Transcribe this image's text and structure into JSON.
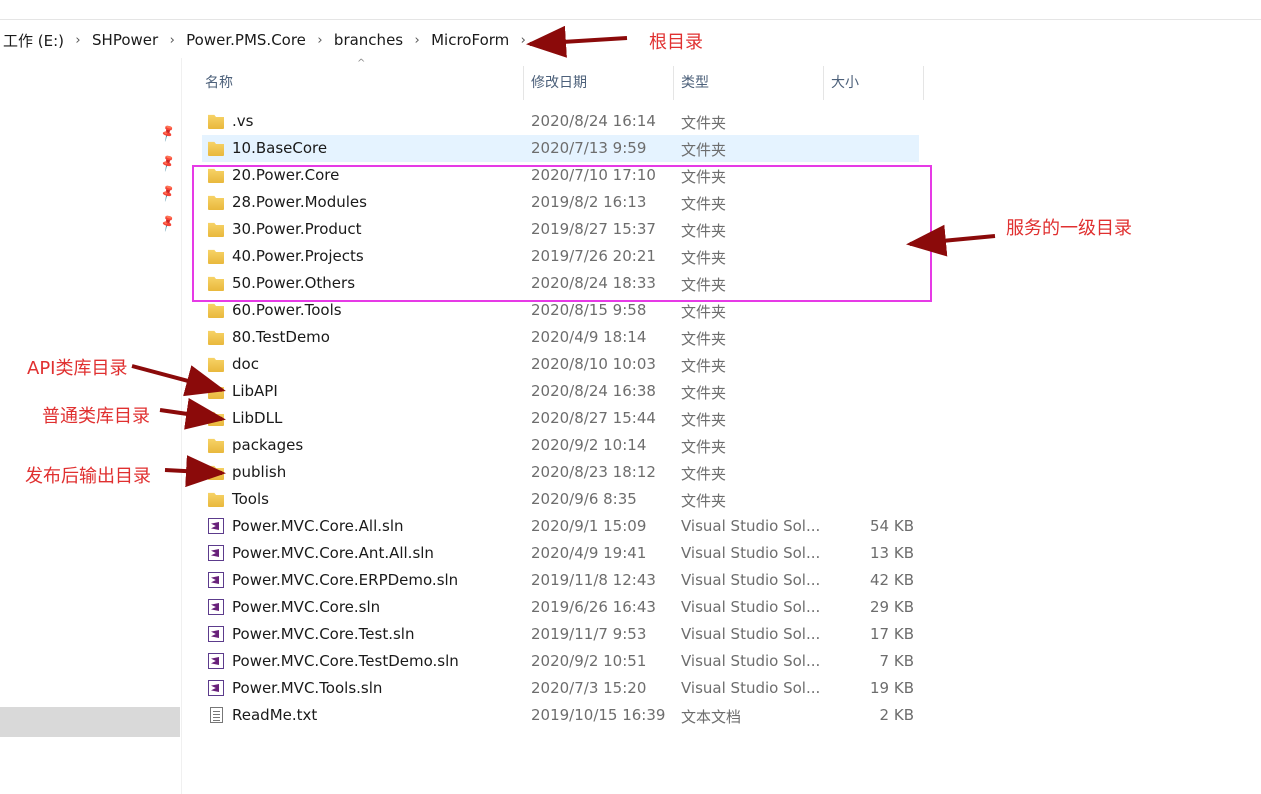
{
  "breadcrumb": [
    "工作 (E:)",
    "SHPower",
    "Power.PMS.Core",
    "branches",
    "MicroForm"
  ],
  "columns": {
    "name": "名称",
    "date": "修改日期",
    "type": "类型",
    "size": "大小"
  },
  "files": [
    {
      "name": ".vs",
      "date": "2020/8/24 16:14",
      "type": "文件夹",
      "size": "",
      "icon": "folder-icon"
    },
    {
      "name": "10.BaseCore",
      "date": "2020/7/13 9:59",
      "type": "文件夹",
      "size": "",
      "icon": "folder-icon",
      "selected": true
    },
    {
      "name": "20.Power.Core",
      "date": "2020/7/10 17:10",
      "type": "文件夹",
      "size": "",
      "icon": "folder-icon"
    },
    {
      "name": "28.Power.Modules",
      "date": "2019/8/2 16:13",
      "type": "文件夹",
      "size": "",
      "icon": "folder-icon"
    },
    {
      "name": "30.Power.Product",
      "date": "2019/8/27 15:37",
      "type": "文件夹",
      "size": "",
      "icon": "folder-icon"
    },
    {
      "name": "40.Power.Projects",
      "date": "2019/7/26 20:21",
      "type": "文件夹",
      "size": "",
      "icon": "folder-icon"
    },
    {
      "name": "50.Power.Others",
      "date": "2020/8/24 18:33",
      "type": "文件夹",
      "size": "",
      "icon": "folder-icon"
    },
    {
      "name": "60.Power.Tools",
      "date": "2020/8/15 9:58",
      "type": "文件夹",
      "size": "",
      "icon": "folder-icon"
    },
    {
      "name": "80.TestDemo",
      "date": "2020/4/9 18:14",
      "type": "文件夹",
      "size": "",
      "icon": "folder-icon"
    },
    {
      "name": "doc",
      "date": "2020/8/10 10:03",
      "type": "文件夹",
      "size": "",
      "icon": "folder-icon"
    },
    {
      "name": "LibAPI",
      "date": "2020/8/24 16:38",
      "type": "文件夹",
      "size": "",
      "icon": "folder-icon"
    },
    {
      "name": "LibDLL",
      "date": "2020/8/27 15:44",
      "type": "文件夹",
      "size": "",
      "icon": "folder-icon"
    },
    {
      "name": "packages",
      "date": "2020/9/2 10:14",
      "type": "文件夹",
      "size": "",
      "icon": "folder-icon"
    },
    {
      "name": "publish",
      "date": "2020/8/23 18:12",
      "type": "文件夹",
      "size": "",
      "icon": "folder-icon"
    },
    {
      "name": "Tools",
      "date": "2020/9/6 8:35",
      "type": "文件夹",
      "size": "",
      "icon": "folder-icon"
    },
    {
      "name": "Power.MVC.Core.All.sln",
      "date": "2020/9/1 15:09",
      "type": "Visual Studio Sol...",
      "size": "54 KB",
      "icon": "sln-icon"
    },
    {
      "name": "Power.MVC.Core.Ant.All.sln",
      "date": "2020/4/9 19:41",
      "type": "Visual Studio Sol...",
      "size": "13 KB",
      "icon": "sln-icon"
    },
    {
      "name": "Power.MVC.Core.ERPDemo.sln",
      "date": "2019/11/8 12:43",
      "type": "Visual Studio Sol...",
      "size": "42 KB",
      "icon": "sln-icon"
    },
    {
      "name": "Power.MVC.Core.sln",
      "date": "2019/6/26 16:43",
      "type": "Visual Studio Sol...",
      "size": "29 KB",
      "icon": "sln-icon"
    },
    {
      "name": "Power.MVC.Core.Test.sln",
      "date": "2019/11/7 9:53",
      "type": "Visual Studio Sol...",
      "size": "17 KB",
      "icon": "sln-icon"
    },
    {
      "name": "Power.MVC.Core.TestDemo.sln",
      "date": "2020/9/2 10:51",
      "type": "Visual Studio Sol...",
      "size": "7 KB",
      "icon": "sln-icon"
    },
    {
      "name": "Power.MVC.Tools.sln",
      "date": "2020/7/3 15:20",
      "type": "Visual Studio Sol...",
      "size": "19 KB",
      "icon": "sln-icon"
    },
    {
      "name": "ReadMe.txt",
      "date": "2019/10/15 16:39",
      "type": "文本文档",
      "size": "2 KB",
      "icon": "txt-icon"
    }
  ],
  "annotations": {
    "root": "根目录",
    "service": "服务的一级目录",
    "api": "API类库目录",
    "common": "普通类库目录",
    "publish": "发布后输出目录"
  },
  "colors": {
    "annotation": "#e03030",
    "arrow": "#8b0a0a",
    "highlight": "#e63ae6",
    "selected_row": "#e5f3ff"
  }
}
